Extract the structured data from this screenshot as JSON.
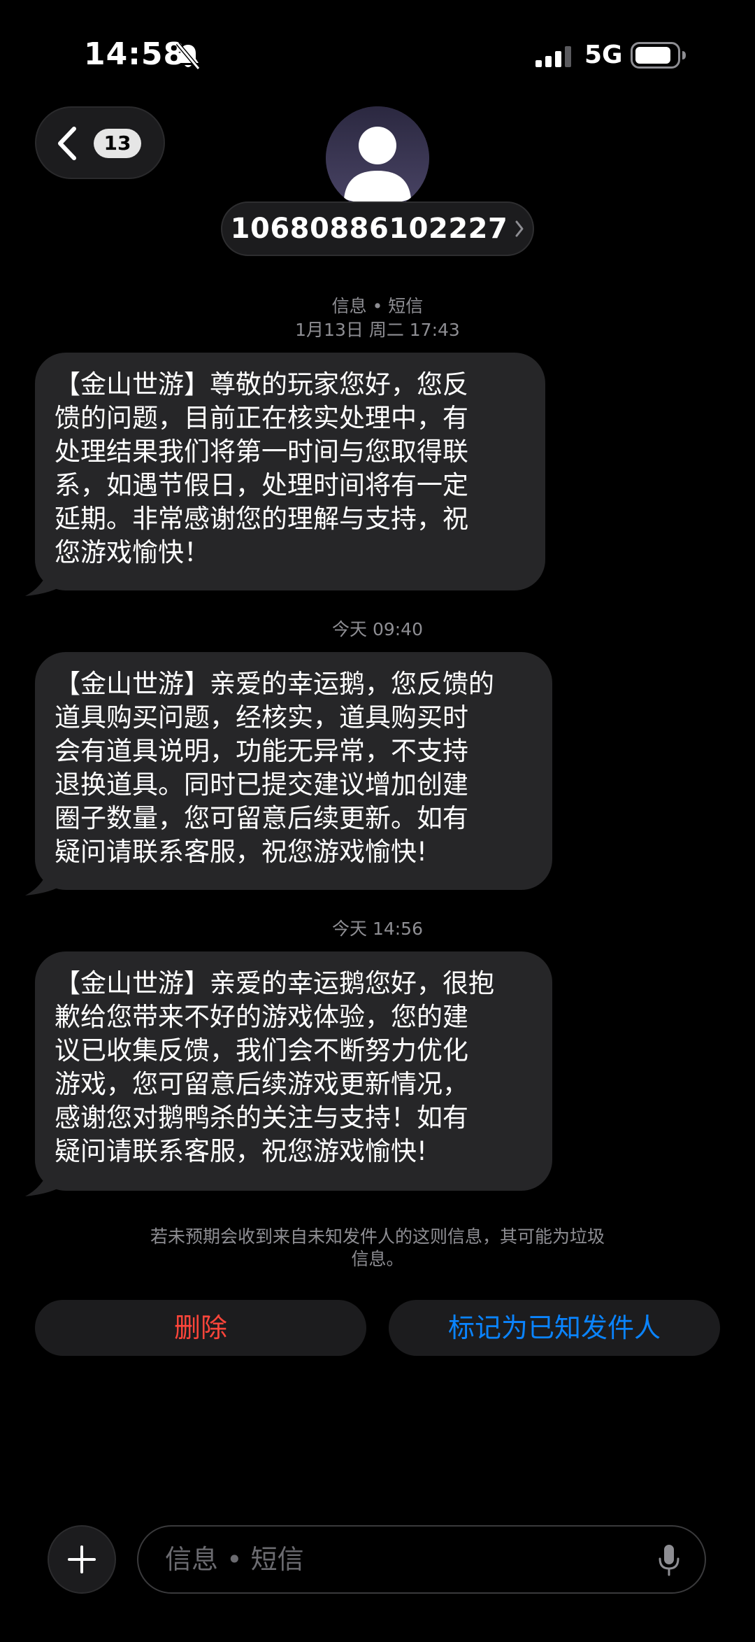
{
  "status_bar": {
    "time": "14:58",
    "network": "5G",
    "icons": [
      "bell-slash-icon",
      "signal-icon",
      "battery-icon"
    ]
  },
  "header": {
    "unread_count": "13",
    "sender_number": "10680886102227",
    "icons": [
      "chevron-left-icon",
      "avatar-icon",
      "chevron-right-icon"
    ]
  },
  "conversation": {
    "service_label": "信息 • 短信",
    "messages": [
      {
        "timestamp": "1月13日 周二 17:43",
        "lines": [
          "【金山世游】尊敬的玩家您好，您反",
          "馈的问题，目前正在核实处理中，有",
          "处理结果我们将第一时间与您取得联",
          "系，如遇节假日，处理时间将有一定",
          "延期。非常感谢您的理解与支持，祝",
          "您游戏愉快！"
        ]
      },
      {
        "timestamp": "今天 09:40",
        "lines": [
          "【金山世游】亲爱的幸运鹅，您反馈的",
          "道具购买问题，经核实，道具购买时",
          "会有道具说明，功能无异常，不支持",
          "退换道具。同时已提交建议增加创建",
          "圈子数量，您可留意后续更新。如有",
          "疑问请联系客服，祝您游戏愉快!"
        ]
      },
      {
        "timestamp": "今天 14:56",
        "lines": [
          "【金山世游】亲爱的幸运鹅您好，很抱",
          "歉给您带来不好的游戏体验，您的建",
          "议已收集反馈，我们会不断努力优化",
          "游戏，您可留意后续游戏更新情况，",
          "感谢您对鹅鸭杀的关注与支持！如有",
          "疑问请联系客服，祝您游戏愉快!"
        ]
      }
    ]
  },
  "unknown_sender": {
    "notice_lines": [
      "若未预期会收到来自未知发件人的这则信息，其可能为垃圾",
      "信息。"
    ],
    "delete_label": "删除",
    "mark_known_label": "标记为已知发件人"
  },
  "composer": {
    "placeholder": "信息 • 短信",
    "value": "",
    "icons": [
      "plus-icon",
      "mic-icon"
    ]
  },
  "colors": {
    "background": "#000000",
    "bubble": "#262628",
    "delete": "#ff453a",
    "accent": "#0a84ff",
    "secondary_text": "#8e8e93"
  }
}
